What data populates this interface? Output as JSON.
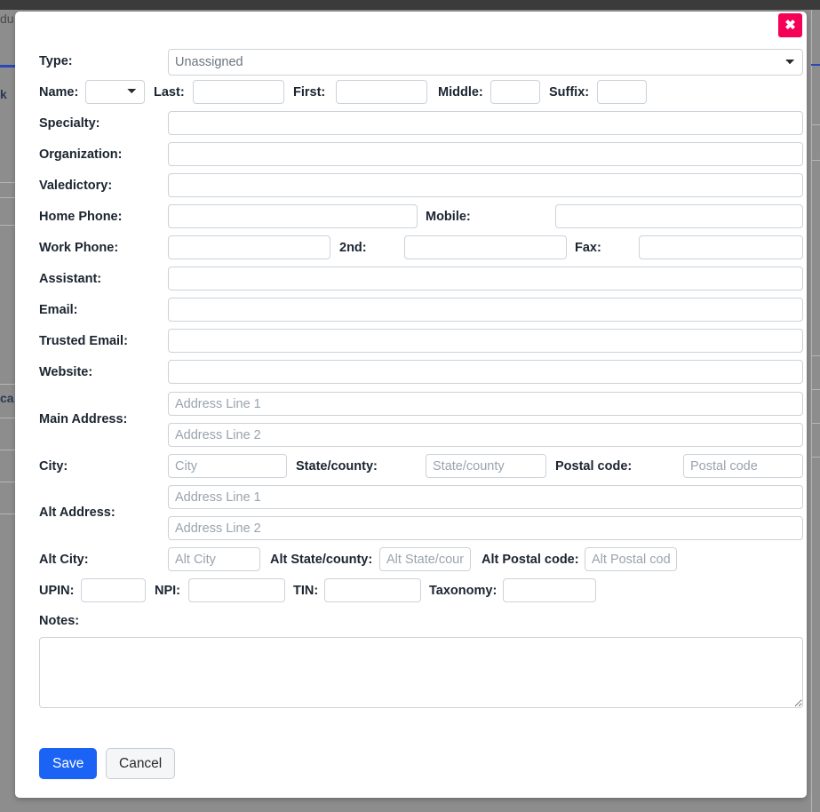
{
  "backdrop": {
    "fragment_top": "du",
    "fragment_mid": "k",
    "fragment_low": "ca"
  },
  "modal": {
    "close_label": "✖",
    "close_icon": "close-icon",
    "type": {
      "label": "Type:",
      "selected": "Unassigned",
      "options": [
        "Unassigned"
      ]
    },
    "name": {
      "label": "Name:",
      "prefix_selected": "",
      "prefix_options": [
        ""
      ],
      "last_label": "Last:",
      "last_value": "",
      "first_label": "First:",
      "first_value": "",
      "middle_label": "Middle:",
      "middle_value": "",
      "suffix_label": "Suffix:",
      "suffix_value": ""
    },
    "specialty": {
      "label": "Specialty:",
      "value": ""
    },
    "organization": {
      "label": "Organization:",
      "value": ""
    },
    "valedictory": {
      "label": "Valedictory:",
      "value": ""
    },
    "home_phone": {
      "label": "Home Phone:",
      "value": ""
    },
    "mobile": {
      "label": "Mobile:",
      "value": ""
    },
    "work_phone": {
      "label": "Work Phone:",
      "value": ""
    },
    "work_phone_2nd": {
      "label": "2nd:",
      "value": ""
    },
    "fax": {
      "label": "Fax:",
      "value": ""
    },
    "assistant": {
      "label": "Assistant:",
      "value": ""
    },
    "email": {
      "label": "Email:",
      "value": ""
    },
    "trusted_email": {
      "label": "Trusted Email:",
      "value": ""
    },
    "website": {
      "label": "Website:",
      "value": ""
    },
    "main_address": {
      "label": "Main Address:",
      "line1_placeholder": "Address Line 1",
      "line1_value": "",
      "line2_placeholder": "Address Line 2",
      "line2_value": ""
    },
    "city_row": {
      "city_label": "City:",
      "city_placeholder": "City",
      "city_value": "",
      "state_label": "State/county:",
      "state_placeholder": "State/county",
      "state_value": "",
      "postal_label": "Postal code:",
      "postal_placeholder": "Postal code",
      "postal_value": ""
    },
    "alt_address": {
      "label": "Alt Address:",
      "line1_placeholder": "Address Line 1",
      "line1_value": "",
      "line2_placeholder": "Address Line 2",
      "line2_value": ""
    },
    "alt_city_row": {
      "city_label": "Alt City:",
      "city_placeholder": "Alt City",
      "city_value": "",
      "state_label": "Alt State/county:",
      "state_placeholder": "Alt State/county",
      "state_value": "",
      "postal_label": "Alt Postal code:",
      "postal_placeholder": "Alt Postal code",
      "postal_value": ""
    },
    "ids_row": {
      "upin_label": "UPIN:",
      "upin_value": "",
      "npi_label": "NPI:",
      "npi_value": "",
      "tin_label": "TIN:",
      "tin_value": "",
      "taxonomy_label": "Taxonomy:",
      "taxonomy_value": ""
    },
    "notes": {
      "label": "Notes:",
      "value": ""
    },
    "actions": {
      "save_label": "Save",
      "cancel_label": "Cancel"
    }
  },
  "colors": {
    "accent_primary": "#1a63f5",
    "close_bg": "#f50057",
    "backdrop": "#8d8d8d",
    "label_text": "#1b2430",
    "placeholder": "#9aa3ad",
    "field_border": "#ccd2d9"
  }
}
